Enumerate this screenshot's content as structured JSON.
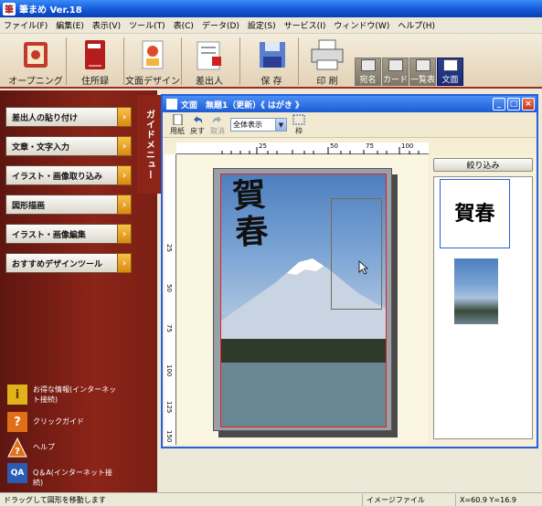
{
  "app": {
    "title": "筆まめ Ver.18"
  },
  "menu": [
    "ファイル(F)",
    "編集(E)",
    "表示(V)",
    "ツール(T)",
    "表(C)",
    "データ(D)",
    "設定(S)",
    "サービス(I)",
    "ウィンドウ(W)",
    "ヘルプ(H)"
  ],
  "toolbar": {
    "items": [
      "オープニング",
      "住所録",
      "文面デザイン",
      "差出人",
      "保 存",
      "印 刷"
    ],
    "modes": [
      "宛名",
      "カード",
      "一覧表",
      "文面"
    ]
  },
  "guide": {
    "tab_label": "ガイドメニュー",
    "items": [
      "差出人の貼り付け",
      "文章・文字入力",
      "イラスト・画像取り込み",
      "図形描画",
      "イラスト・画像編集",
      "おすすめデザインツール"
    ],
    "links": [
      "お得な情報(インターネット接続)",
      "クリックガイド",
      "ヘルプ",
      "Q＆A(インターネット接続)"
    ]
  },
  "doc": {
    "title": "文面　無題1（更新）《 はがき 》",
    "tools": {
      "paper": "用紙",
      "undo": "戻す",
      "cancel": "取消",
      "frame": "枠"
    },
    "zoom_value": "全体表示",
    "ruler_h": [
      "25",
      "50",
      "75",
      "100"
    ],
    "ruler_v": [
      "25",
      "50",
      "75",
      "100",
      "125",
      "150"
    ],
    "card_text": "賀春",
    "side_button": "絞り込み",
    "thumb_text": "賀春"
  },
  "status": {
    "message": "ドラッグして図形を移動します",
    "file_type": "イメージファイル",
    "coords": "X=60.9  Y=16.9"
  }
}
